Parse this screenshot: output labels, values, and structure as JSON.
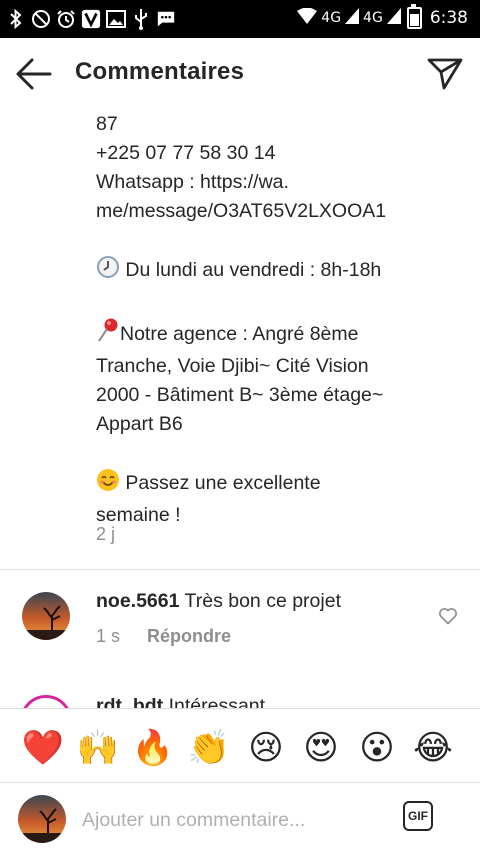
{
  "status_bar": {
    "network_1": "4G",
    "network_2": "4G",
    "time": "6:38",
    "icons": [
      "bluetooth-icon",
      "do-not-disturb-icon",
      "alarm-icon",
      "v-app-icon",
      "image-icon",
      "usb-icon",
      "message-icon",
      "wifi-icon",
      "signal-icon",
      "battery-icon"
    ]
  },
  "header": {
    "title": "Commentaires",
    "back_icon": "arrow-left-icon",
    "send_icon": "paper-plane-icon"
  },
  "comment_main": {
    "lines": [
      "87",
      "+225 07 77 58 30 14",
      "Whatsapp : https://wa.",
      "me/message/O3AT65V2LXOOA1",
      "",
      "Du lundi au vendredi : 8h-18h",
      "",
      "Notre agence : Angré 8ème",
      "Tranche, Voie Djibi~ Cité Vision",
      "2000 - Bâtiment B~ 3ème étage~",
      "Appart B6",
      "",
      "Passez une excellente",
      "semaine !"
    ],
    "time": "2 j"
  },
  "comment_2": {
    "username": "noe.5661",
    "text": "Très bon ce projet",
    "time": "1 s",
    "reply_label": "Répondre"
  },
  "comment_3": {
    "username": "rdt_bdt",
    "text": "Intéressant"
  },
  "reactions": [
    "❤️",
    "🙌",
    "🔥",
    "👏",
    "😢",
    "😍",
    "😮",
    "😂"
  ],
  "composer": {
    "placeholder": "Ajouter un commentaire...",
    "gif_label": "GIF"
  },
  "colors": {
    "text": "#262626",
    "muted": "#8e8e8e",
    "divider": "#dbdbdb",
    "story_ring": "#d6249f"
  }
}
